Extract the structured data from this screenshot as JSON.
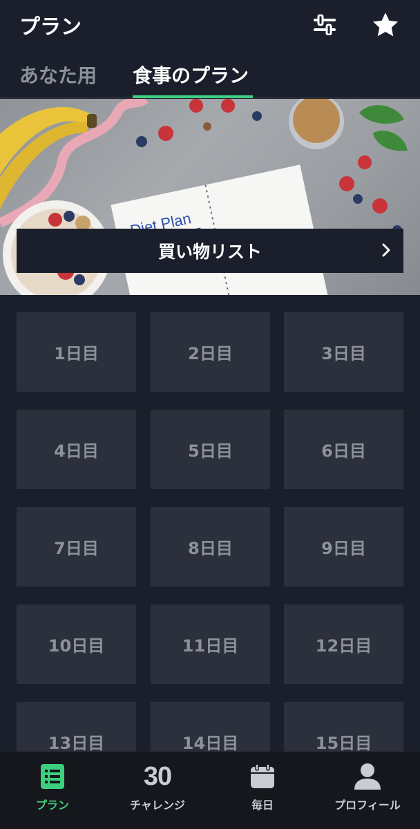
{
  "header": {
    "title": "プラン",
    "filter_icon": "sliders-icon",
    "favorite_icon": "star-icon"
  },
  "tabs": [
    {
      "label": "あなた用",
      "active": false
    },
    {
      "label": "食事のプラン",
      "active": true
    }
  ],
  "banner": {
    "notebook_text": "Diet Plan",
    "shopping_list_label": "買い物リスト",
    "chevron_icon": "chevron-right-icon"
  },
  "days": [
    {
      "label": "1日目"
    },
    {
      "label": "2日目"
    },
    {
      "label": "3日目"
    },
    {
      "label": "4日目"
    },
    {
      "label": "5日目"
    },
    {
      "label": "6日目"
    },
    {
      "label": "7日目"
    },
    {
      "label": "8日目"
    },
    {
      "label": "9日目"
    },
    {
      "label": "10日目"
    },
    {
      "label": "11日目"
    },
    {
      "label": "12日目"
    },
    {
      "label": "13日目"
    },
    {
      "label": "14日目"
    },
    {
      "label": "15日目"
    }
  ],
  "bottom_nav": [
    {
      "label": "プラン",
      "icon": "list-icon",
      "active": true
    },
    {
      "label": "チャレンジ",
      "icon": "thirty-icon",
      "icon_text": "30",
      "active": false
    },
    {
      "label": "毎日",
      "icon": "calendar-icon",
      "active": false
    },
    {
      "label": "プロフィール",
      "icon": "person-icon",
      "active": false
    }
  ],
  "colors": {
    "background": "#1b1f2c",
    "cell": "#2c303c",
    "accent": "#3ecf7e",
    "nav_background": "#15171c"
  }
}
